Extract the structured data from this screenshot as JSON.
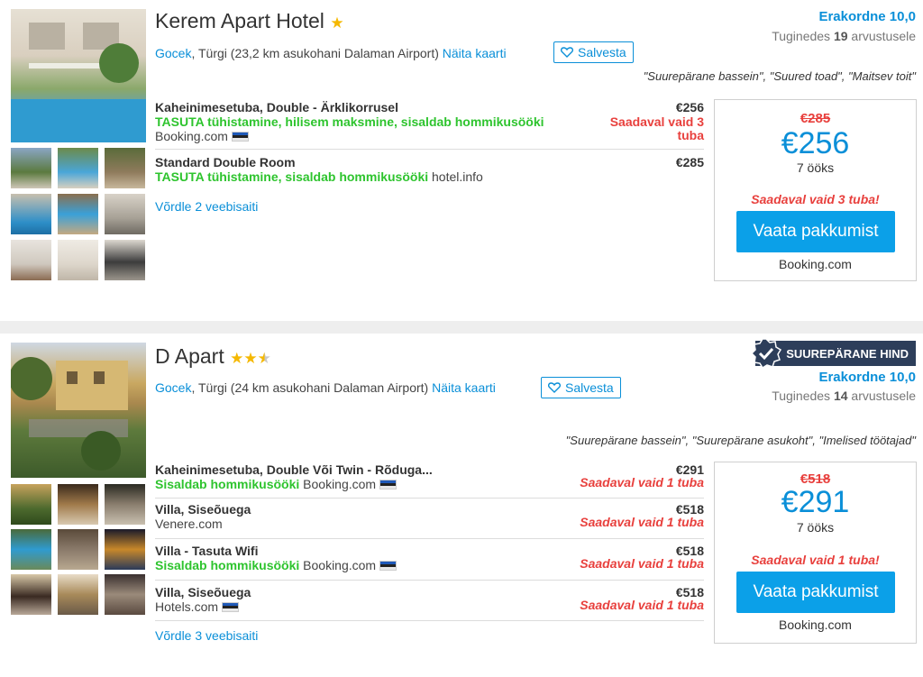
{
  "hotels": [
    {
      "name": "Kerem Apart Hotel",
      "city": "Gocek",
      "location_rest": ", Türgi (23,2 km asukohani Dalaman Airport)",
      "map_link": "Näita kaarti",
      "save_label": "Salvesta",
      "rating_label": "Erakordne 10,0",
      "reviews_prefix": "Tuginedes ",
      "reviews_count": "19",
      "reviews_suffix": " arvustusele",
      "quotes": "\"Suurepärane bassein\", \"Suured toad\", \"Maitsev toit\"",
      "deals": [
        {
          "title": "Kaheinimesetuba, Double - Ärklikorrusel",
          "perks": "TASUTA tühistamine, hilisem maksmine, sisaldab hommikusööki",
          "provider": "Booking.com",
          "price": "€256",
          "availability": "Saadaval vaid 3 tuba"
        },
        {
          "title": "Standard Double Room",
          "perks": "TASUTA tühistamine, sisaldab hommikusööki",
          "provider": "hotel.info",
          "price": "€285",
          "availability": ""
        }
      ],
      "compare_link": "Võrdle 2 veebisaiti",
      "box": {
        "old_price": "€285",
        "price": "€256",
        "nights": "7 ööks",
        "availability": "Saadaval vaid 3 tuba!",
        "cta": "Vaata pakkumist",
        "provider": "Booking.com"
      }
    },
    {
      "name": "D Apart",
      "city": "Gocek",
      "location_rest": ", Türgi (24 km asukohani Dalaman Airport)",
      "map_link": "Näita kaarti",
      "save_label": "Salvesta",
      "badge": "SUUREPÄRANE HIND",
      "rating_label": "Erakordne 10,0",
      "reviews_prefix": "Tuginedes ",
      "reviews_count": "14",
      "reviews_suffix": " arvustusele",
      "quotes": "\"Suurepärane bassein\", \"Suurepärane asukoht\", \"Imelised töötajad\"",
      "deals": [
        {
          "title": "Kaheinimesetuba, Double Või Twin - Rõduga...",
          "perks": "Sisaldab hommikusööki",
          "provider": "Booking.com",
          "price": "€291",
          "availability": "Saadaval vaid 1 tuba"
        },
        {
          "title": "Villa, Siseõuega",
          "perks": "",
          "provider": "Venere.com",
          "price": "€518",
          "availability": "Saadaval vaid 1 tuba"
        },
        {
          "title": "Villa - Tasuta Wifi",
          "perks": "Sisaldab hommikusööki",
          "provider": "Booking.com",
          "price": "€518",
          "availability": "Saadaval vaid 1 tuba"
        },
        {
          "title": "Villa, Siseõuega",
          "perks": "",
          "provider": "Hotels.com",
          "price": "€518",
          "availability": "Saadaval vaid 1 tuba"
        }
      ],
      "compare_link": "Võrdle 3 veebisaiti",
      "box": {
        "old_price": "€518",
        "price": "€291",
        "nights": "7 ööks",
        "availability": "Saadaval vaid 1 tuba!",
        "cta": "Vaata pakkumist",
        "provider": "Booking.com"
      }
    }
  ],
  "stars": {
    "hotel1": 1,
    "hotel2": 2.5
  },
  "colors": {
    "link": "#0a8fd8",
    "green": "#2ec42e",
    "red": "#e8403d",
    "cta": "#0ba0e8",
    "badge": "#2d3e5a"
  }
}
